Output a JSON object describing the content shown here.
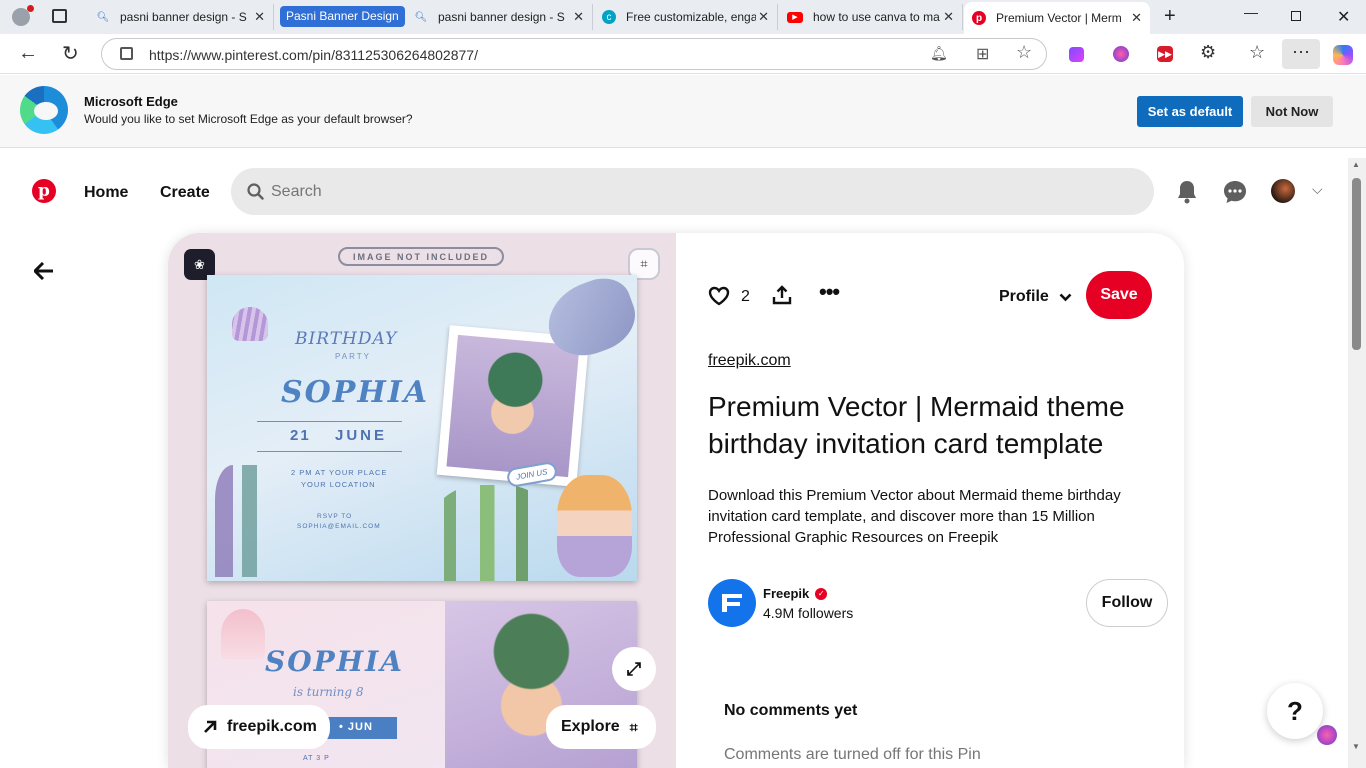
{
  "browser": {
    "tabs": [
      {
        "title": "pasni banner design - S",
        "icon": "search-icon"
      },
      {
        "title": "pasni banner design - S",
        "icon": "search-icon"
      },
      {
        "title": "Free customizable, enga",
        "icon": "canva-icon"
      },
      {
        "title": "how to use canva to ma",
        "icon": "youtube-icon"
      },
      {
        "title": "Premium Vector | Merm",
        "icon": "pinterest-icon"
      }
    ],
    "tab_group_label": "Pasni Banner Design",
    "url": "https://www.pinterest.com/pin/831125306264802877/"
  },
  "infobar": {
    "title": "Microsoft Edge",
    "message": "Would you like to set Microsoft Edge as your default browser?",
    "primary_label": "Set as default",
    "secondary_label": "Not Now"
  },
  "pinterest": {
    "nav": {
      "home": "Home",
      "create": "Create"
    },
    "search": {
      "placeholder": "Search"
    },
    "pin": {
      "reactions": "2",
      "profile_label": "Profile",
      "save_label": "Save",
      "source_link": "freepik.com",
      "title": "Premium Vector | Mermaid theme birthday invitation card template",
      "description": "Download this Premium Vector about Mermaid theme birthday invitation card template, and discover more than 15 Million Professional Graphic Resources on Freepik",
      "creator_name": "Freepik",
      "creator_followers": "4.9M followers",
      "follow_label": "Follow",
      "comments_heading": "No comments yet",
      "comments_note": "Comments are turned off for this Pin",
      "image_badge": "IMAGE NOT INCLUDED",
      "visit_label": "freepik.com",
      "explore_label": "Explore",
      "help_label": "?"
    },
    "artwork": {
      "card_a": {
        "title": "BIRTHDAY",
        "subtitle": "PARTY",
        "name": "SOPHIA",
        "day": "21",
        "month": "JUNE",
        "time": "2 PM AT YOUR PLACE",
        "place": "YOUR LOCATION",
        "rsvp": "RSVP TO",
        "email": "SOPHIA@EMAIL.COM",
        "tag": "JOIN US"
      },
      "card_b": {
        "name": "SOPHIA",
        "subtitle": "is turning 8",
        "date_tag": "• JUN",
        "time": "AT 3 P"
      }
    }
  },
  "colors": {
    "pinterest_red": "#e60023",
    "edge_blue": "#0f6cbd",
    "tab_group_blue": "#2f6fd6",
    "freepik_blue": "#1273eb"
  }
}
